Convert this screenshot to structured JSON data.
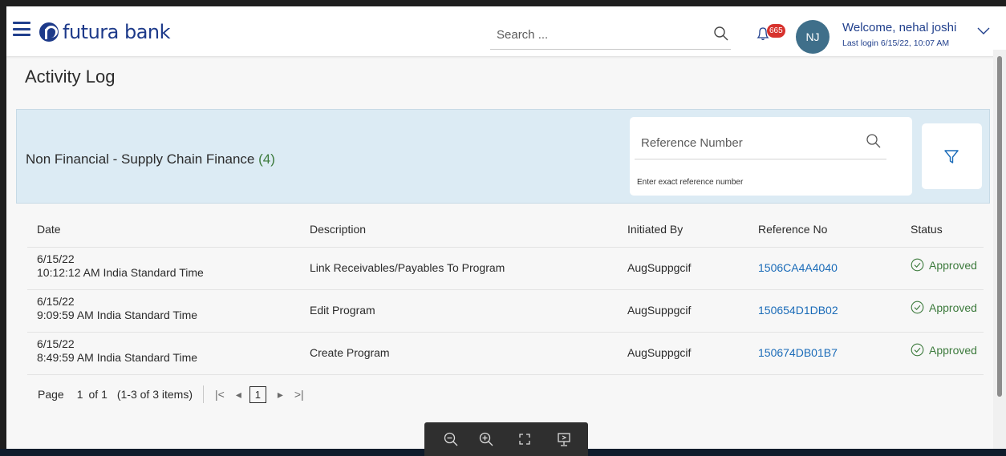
{
  "header": {
    "brand": "futura bank",
    "search_placeholder": "Search ...",
    "notification_count": "665",
    "avatar_initials": "NJ",
    "welcome": "Welcome, nehal joshi",
    "last_login": "Last login 6/15/22, 10:07 AM"
  },
  "page": {
    "title": "Activity Log"
  },
  "panel": {
    "title": "Non Financial - Supply Chain Finance",
    "count": "(4)",
    "reference_placeholder": "Reference Number",
    "reference_hint": "Enter exact reference number"
  },
  "table": {
    "columns": [
      "Date",
      "Description",
      "Initiated By",
      "Reference No",
      "Status"
    ],
    "rows": [
      {
        "date": "6/15/22",
        "time": "10:12:12 AM India Standard Time",
        "description": "Link Receivables/Payables To Program",
        "initiated_by": "AugSuppgcif",
        "reference": "1506CA4A4040",
        "status": "Approved"
      },
      {
        "date": "6/15/22",
        "time": "9:09:59 AM India Standard Time",
        "description": "Edit Program",
        "initiated_by": "AugSuppgcif",
        "reference": "150654D1DB02",
        "status": "Approved"
      },
      {
        "date": "6/15/22",
        "time": "8:49:59 AM India Standard Time",
        "description": "Create Program",
        "initiated_by": "AugSuppgcif",
        "reference": "150674DB01B7",
        "status": "Approved"
      }
    ]
  },
  "pagination": {
    "label": "Page",
    "page": "1",
    "of": "of 1",
    "items": "(1-3 of 3 items)",
    "current": "1",
    "first_icon": "first-page-icon",
    "prev_icon": "prev-page-icon",
    "next_icon": "next-page-icon",
    "last_icon": "last-page-icon"
  },
  "colors": {
    "brand": "#1d3a8a",
    "link": "#1a6bb8",
    "approved": "#3c7a3c",
    "panel_bg": "#dcebf4",
    "badge": "#d7322d"
  }
}
